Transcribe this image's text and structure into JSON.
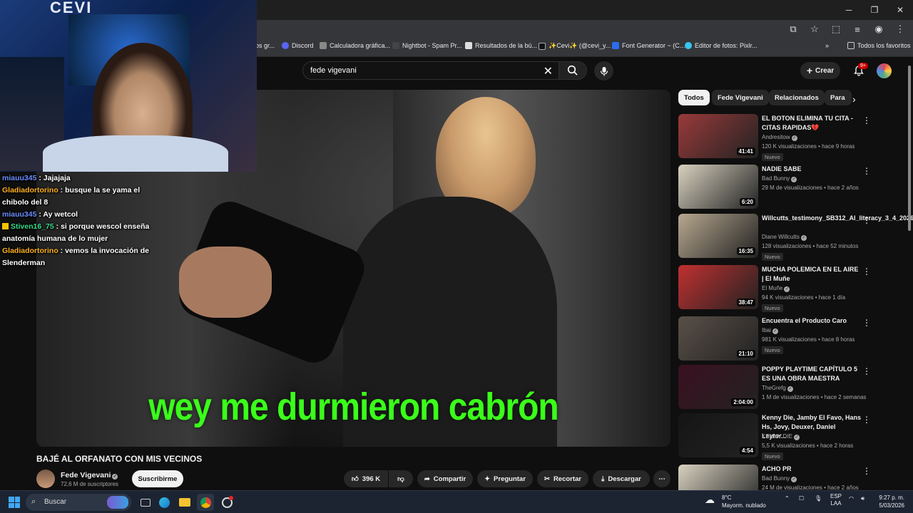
{
  "browser": {
    "bookmarks": [
      {
        "label": "os gr..."
      },
      {
        "label": "Discord"
      },
      {
        "label": "Calculadora gráfica..."
      },
      {
        "label": "Nightbot - Spam Pr..."
      },
      {
        "label": "Resultados de la bú..."
      },
      {
        "label": "✨Cevi✨ (@cevi_y..."
      },
      {
        "label": "Font Generator ~ (C..."
      },
      {
        "label": "Editor de fotos: Pixlr..."
      }
    ],
    "all_favorites": "Todos los favoritos"
  },
  "header": {
    "search_query": "fede vigevani",
    "create_label": "Crear",
    "notif_badge": "9+"
  },
  "overlay": {
    "cam_text": "CEVI",
    "chat": [
      {
        "user": "miauu345",
        "sep": " : ",
        "msg": "Jajajaja",
        "color": "#6a8dff"
      },
      {
        "user": "Gladiadortorino",
        "sep": " : ",
        "msg": "busque la se yama el chibolo del 8",
        "color": "#ffb020"
      },
      {
        "user": "miauu345",
        "sep": " : ",
        "msg": "Ay wetcol",
        "color": "#6a8dff"
      },
      {
        "user": "Stiven16_75",
        "sep": " : ",
        "msg": "si porque wescol enseña anatomía humana de lo mujer",
        "color": "#33dd88"
      },
      {
        "user": "Gladiadortorino",
        "sep": " : ",
        "msg": "vemos la invocación de Slenderman",
        "color": "#ffb020"
      }
    ]
  },
  "video": {
    "subtitle": "wey me durmieron cabrón",
    "title": "BAJÉ AL ORFANATO CON MIS VECINOS",
    "channel": "Fede Vigevani",
    "subscribers": "72,6 M de suscriptores",
    "subscribe_label": "Suscribirme",
    "likes": "396 K",
    "share_label": "Compartir",
    "ask_label": "Preguntar",
    "clip_label": "Recortar",
    "download_label": "Descargar"
  },
  "rail": {
    "chips": [
      "Todos",
      "Fede Vigevani",
      "Relacionados",
      "Para"
    ],
    "items": [
      {
        "title": "EL BOTON ELIMINA TU CITA - CITAS RAPIDAS💔",
        "channel": "Andresitow",
        "meta": "120 K visualizaciones • hace 9 horas",
        "duration": "41:41",
        "badge": "Nuevo",
        "thumb": "#9a3a3a"
      },
      {
        "title": "NADIE SABE",
        "channel": "Bad Bunny",
        "meta": "29 M de visualizaciones • hace 2 años",
        "duration": "6:20",
        "badge": "",
        "thumb": "#d9d2c0"
      },
      {
        "title": "Willcutts_testimony_SB312_AI_literacy_3_4_2026",
        "channel": "Diane Willcutts",
        "meta": "128 visualizaciones • hace 52 minutos",
        "duration": "16:35",
        "badge": "Nuevo",
        "thumb": "#b8a890"
      },
      {
        "title": "MUCHA POLEMICA EN EL AIRE | El Muñe",
        "channel": "El Muñe",
        "meta": "94 K visualizaciones • hace 1 día",
        "duration": "38:47",
        "badge": "Nuevo",
        "thumb": "#c03030"
      },
      {
        "title": "Encuentra el Producto Caro",
        "channel": "Ibai",
        "meta": "981 K visualizaciones • hace 8 horas",
        "duration": "21:10",
        "badge": "Nuevo",
        "thumb": "#5a5048"
      },
      {
        "title": "POPPY PLAYTIME CAPÍTULO 5 ES UNA OBRA MAESTRA",
        "channel": "TheGrefg",
        "meta": "1 M de visualizaciones • hace 2 semanas",
        "duration": "2:04:00",
        "badge": "",
        "thumb": "#3a1020"
      },
      {
        "title": "Kenny Die, Jamby El Favo, Hans Hs, Jovy, Deuxer, Daniel Leytor...",
        "channel": "KENNY DIE",
        "meta": "5,5 K visualizaciones • hace 2 horas",
        "duration": "4:54",
        "badge": "Nuevo",
        "thumb": "#151515"
      },
      {
        "title": "ACHO PR",
        "channel": "Bad Bunny",
        "meta": "24 M de visualizaciones • hace 2 años",
        "duration": "",
        "badge": "",
        "thumb": "#d9d2c0"
      }
    ]
  },
  "taskbar": {
    "search_label": "Buscar",
    "temp": "8°C",
    "weather": "Mayorm. nublado",
    "lang1": "ESP",
    "lang2": "LAA",
    "time": "9:27 p. m.",
    "date": "5/03/2026"
  }
}
